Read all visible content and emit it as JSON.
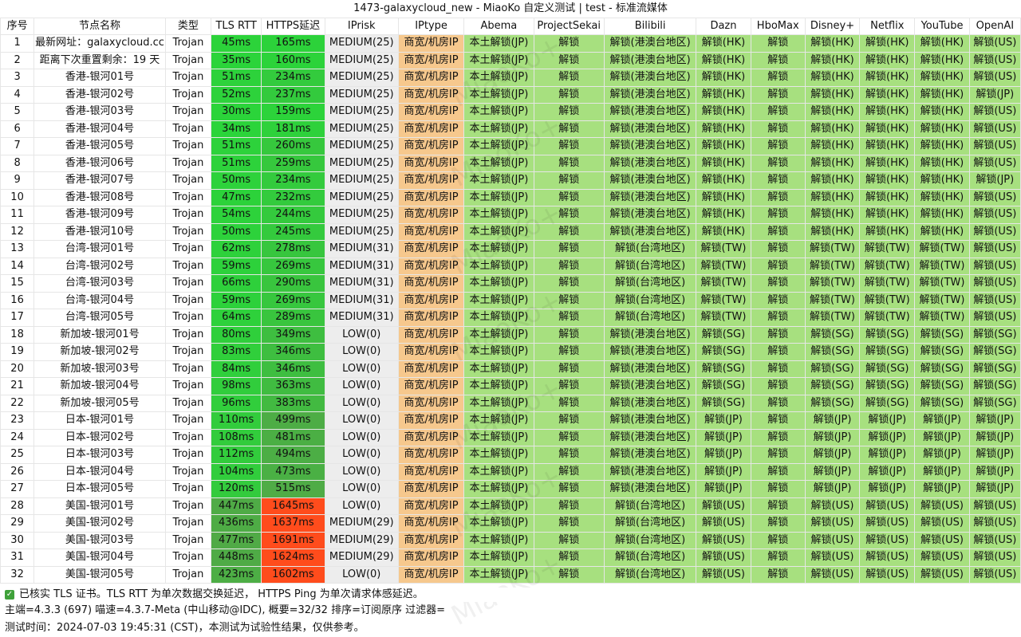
{
  "title": "1473-galaxycloud_new - MiaoKo 自定义测试 | test - 标准流媒体",
  "headers": [
    "序号",
    "节点名称",
    "类型",
    "TLS RTT",
    "HTTPS延迟",
    "IPrisk",
    "IPtype",
    "Abema",
    "ProjectSekai",
    "Bilibili",
    "Dazn",
    "HboMax",
    "Disney+",
    "Netflix",
    "YouTube",
    "OpenAI"
  ],
  "rows": [
    [
      "1",
      "最新网址：galaxycloud.cc",
      "Trojan",
      "45ms",
      "165ms",
      "MEDIUM(25)",
      "商宽/机房IP",
      "本土解锁(JP)",
      "解锁",
      "解锁(港澳台地区)",
      "解锁(HK)",
      "解锁",
      "解锁(HK)",
      "解锁(HK)",
      "解锁(HK)",
      "解锁(US)"
    ],
    [
      "2",
      "距离下次重置剩余：19 天",
      "Trojan",
      "35ms",
      "160ms",
      "MEDIUM(25)",
      "商宽/机房IP",
      "本土解锁(JP)",
      "解锁",
      "解锁(港澳台地区)",
      "解锁(HK)",
      "解锁",
      "解锁(HK)",
      "解锁(HK)",
      "解锁(HK)",
      "解锁(US)"
    ],
    [
      "3",
      "香港-银河01号",
      "Trojan",
      "51ms",
      "234ms",
      "MEDIUM(25)",
      "商宽/机房IP",
      "本土解锁(JP)",
      "解锁",
      "解锁(港澳台地区)",
      "解锁(HK)",
      "解锁",
      "解锁(HK)",
      "解锁(HK)",
      "解锁(HK)",
      "解锁(US)"
    ],
    [
      "4",
      "香港-银河02号",
      "Trojan",
      "52ms",
      "237ms",
      "MEDIUM(25)",
      "商宽/机房IP",
      "本土解锁(JP)",
      "解锁",
      "解锁(港澳台地区)",
      "解锁(HK)",
      "解锁",
      "解锁(HK)",
      "解锁(HK)",
      "解锁(HK)",
      "解锁(JP)"
    ],
    [
      "5",
      "香港-银河03号",
      "Trojan",
      "30ms",
      "159ms",
      "MEDIUM(25)",
      "商宽/机房IP",
      "本土解锁(JP)",
      "解锁",
      "解锁(港澳台地区)",
      "解锁(HK)",
      "解锁",
      "解锁(HK)",
      "解锁(HK)",
      "解锁(HK)",
      "解锁(US)"
    ],
    [
      "6",
      "香港-银河04号",
      "Trojan",
      "34ms",
      "181ms",
      "MEDIUM(25)",
      "商宽/机房IP",
      "本土解锁(JP)",
      "解锁",
      "解锁(港澳台地区)",
      "解锁(HK)",
      "解锁",
      "解锁(HK)",
      "解锁(HK)",
      "解锁(HK)",
      "解锁(US)"
    ],
    [
      "7",
      "香港-银河05号",
      "Trojan",
      "51ms",
      "260ms",
      "MEDIUM(25)",
      "商宽/机房IP",
      "本土解锁(JP)",
      "解锁",
      "解锁(港澳台地区)",
      "解锁(HK)",
      "解锁",
      "解锁(HK)",
      "解锁(HK)",
      "解锁(HK)",
      "解锁(US)"
    ],
    [
      "8",
      "香港-银河06号",
      "Trojan",
      "51ms",
      "259ms",
      "MEDIUM(25)",
      "商宽/机房IP",
      "本土解锁(JP)",
      "解锁",
      "解锁(港澳台地区)",
      "解锁(HK)",
      "解锁",
      "解锁(HK)",
      "解锁(HK)",
      "解锁(HK)",
      "解锁(US)"
    ],
    [
      "9",
      "香港-银河07号",
      "Trojan",
      "50ms",
      "234ms",
      "MEDIUM(25)",
      "商宽/机房IP",
      "本土解锁(JP)",
      "解锁",
      "解锁(港澳台地区)",
      "解锁(HK)",
      "解锁",
      "解锁(HK)",
      "解锁(HK)",
      "解锁(HK)",
      "解锁(JP)"
    ],
    [
      "10",
      "香港-银河08号",
      "Trojan",
      "47ms",
      "232ms",
      "MEDIUM(25)",
      "商宽/机房IP",
      "本土解锁(JP)",
      "解锁",
      "解锁(港澳台地区)",
      "解锁(HK)",
      "解锁",
      "解锁(HK)",
      "解锁(HK)",
      "解锁(HK)",
      "解锁(US)"
    ],
    [
      "11",
      "香港-银河09号",
      "Trojan",
      "54ms",
      "244ms",
      "MEDIUM(25)",
      "商宽/机房IP",
      "本土解锁(JP)",
      "解锁",
      "解锁(港澳台地区)",
      "解锁(HK)",
      "解锁",
      "解锁(HK)",
      "解锁(HK)",
      "解锁(HK)",
      "解锁(US)"
    ],
    [
      "12",
      "香港-银河10号",
      "Trojan",
      "50ms",
      "245ms",
      "MEDIUM(25)",
      "商宽/机房IP",
      "本土解锁(JP)",
      "解锁",
      "解锁(港澳台地区)",
      "解锁(HK)",
      "解锁",
      "解锁(HK)",
      "解锁(HK)",
      "解锁(HK)",
      "解锁(US)"
    ],
    [
      "13",
      "台湾-银河01号",
      "Trojan",
      "62ms",
      "278ms",
      "MEDIUM(31)",
      "商宽/机房IP",
      "本土解锁(JP)",
      "解锁",
      "解锁(台湾地区)",
      "解锁(TW)",
      "解锁",
      "解锁(TW)",
      "解锁(TW)",
      "解锁(TW)",
      "解锁(US)"
    ],
    [
      "14",
      "台湾-银河02号",
      "Trojan",
      "59ms",
      "269ms",
      "MEDIUM(31)",
      "商宽/机房IP",
      "本土解锁(JP)",
      "解锁",
      "解锁(台湾地区)",
      "解锁(TW)",
      "解锁",
      "解锁(TW)",
      "解锁(TW)",
      "解锁(TW)",
      "解锁(US)"
    ],
    [
      "15",
      "台湾-银河03号",
      "Trojan",
      "66ms",
      "290ms",
      "MEDIUM(31)",
      "商宽/机房IP",
      "本土解锁(JP)",
      "解锁",
      "解锁(台湾地区)",
      "解锁(TW)",
      "解锁",
      "解锁(TW)",
      "解锁(TW)",
      "解锁(TW)",
      "解锁(US)"
    ],
    [
      "16",
      "台湾-银河04号",
      "Trojan",
      "59ms",
      "269ms",
      "MEDIUM(31)",
      "商宽/机房IP",
      "本土解锁(JP)",
      "解锁",
      "解锁(台湾地区)",
      "解锁(TW)",
      "解锁",
      "解锁(TW)",
      "解锁(TW)",
      "解锁(TW)",
      "解锁(US)"
    ],
    [
      "17",
      "台湾-银河05号",
      "Trojan",
      "64ms",
      "289ms",
      "MEDIUM(31)",
      "商宽/机房IP",
      "本土解锁(JP)",
      "解锁",
      "解锁(台湾地区)",
      "解锁(TW)",
      "解锁",
      "解锁(TW)",
      "解锁(TW)",
      "解锁(TW)",
      "解锁(US)"
    ],
    [
      "18",
      "新加坡-银河01号",
      "Trojan",
      "80ms",
      "349ms",
      "LOW(0)",
      "商宽/机房IP",
      "本土解锁(JP)",
      "解锁",
      "解锁(港澳台地区)",
      "解锁(SG)",
      "解锁",
      "解锁(SG)",
      "解锁(SG)",
      "解锁(SG)",
      "解锁(SG)"
    ],
    [
      "19",
      "新加坡-银河02号",
      "Trojan",
      "83ms",
      "346ms",
      "LOW(0)",
      "商宽/机房IP",
      "本土解锁(JP)",
      "解锁",
      "解锁(港澳台地区)",
      "解锁(SG)",
      "解锁",
      "解锁(SG)",
      "解锁(SG)",
      "解锁(SG)",
      "解锁(SG)"
    ],
    [
      "20",
      "新加坡-银河03号",
      "Trojan",
      "84ms",
      "346ms",
      "LOW(0)",
      "商宽/机房IP",
      "本土解锁(JP)",
      "解锁",
      "解锁(港澳台地区)",
      "解锁(SG)",
      "解锁",
      "解锁(SG)",
      "解锁(SG)",
      "解锁(SG)",
      "解锁(SG)"
    ],
    [
      "21",
      "新加坡-银河04号",
      "Trojan",
      "98ms",
      "363ms",
      "LOW(0)",
      "商宽/机房IP",
      "本土解锁(JP)",
      "解锁",
      "解锁(港澳台地区)",
      "解锁(SG)",
      "解锁",
      "解锁(SG)",
      "解锁(SG)",
      "解锁(SG)",
      "解锁(SG)"
    ],
    [
      "22",
      "新加坡-银河05号",
      "Trojan",
      "96ms",
      "383ms",
      "LOW(0)",
      "商宽/机房IP",
      "本土解锁(JP)",
      "解锁",
      "解锁(港澳台地区)",
      "解锁(SG)",
      "解锁",
      "解锁(SG)",
      "解锁(SG)",
      "解锁(SG)",
      "解锁(SG)"
    ],
    [
      "23",
      "日本-银河01号",
      "Trojan",
      "110ms",
      "499ms",
      "LOW(0)",
      "商宽/机房IP",
      "本土解锁(JP)",
      "解锁",
      "解锁(港澳台地区)",
      "解锁(JP)",
      "解锁",
      "解锁(JP)",
      "解锁(JP)",
      "解锁(JP)",
      "解锁(JP)"
    ],
    [
      "24",
      "日本-银河02号",
      "Trojan",
      "108ms",
      "481ms",
      "LOW(0)",
      "商宽/机房IP",
      "本土解锁(JP)",
      "解锁",
      "解锁(港澳台地区)",
      "解锁(JP)",
      "解锁",
      "解锁(JP)",
      "解锁(JP)",
      "解锁(JP)",
      "解锁(JP)"
    ],
    [
      "25",
      "日本-银河03号",
      "Trojan",
      "112ms",
      "494ms",
      "LOW(0)",
      "商宽/机房IP",
      "本土解锁(JP)",
      "解锁",
      "解锁(港澳台地区)",
      "解锁(JP)",
      "解锁",
      "解锁(JP)",
      "解锁(JP)",
      "解锁(JP)",
      "解锁(JP)"
    ],
    [
      "26",
      "日本-银河04号",
      "Trojan",
      "104ms",
      "473ms",
      "LOW(0)",
      "商宽/机房IP",
      "本土解锁(JP)",
      "解锁",
      "解锁(港澳台地区)",
      "解锁(JP)",
      "解锁",
      "解锁(JP)",
      "解锁(JP)",
      "解锁(JP)",
      "解锁(JP)"
    ],
    [
      "27",
      "日本-银河05号",
      "Trojan",
      "120ms",
      "515ms",
      "LOW(0)",
      "商宽/机房IP",
      "本土解锁(JP)",
      "解锁",
      "解锁(港澳台地区)",
      "解锁(JP)",
      "解锁",
      "解锁(JP)",
      "解锁(JP)",
      "解锁(JP)",
      "解锁(JP)"
    ],
    [
      "28",
      "美国-银河01号",
      "Trojan",
      "447ms",
      "1645ms",
      "LOW(0)",
      "商宽/机房IP",
      "本土解锁(JP)",
      "解锁",
      "解锁(台湾地区)",
      "解锁(US)",
      "解锁",
      "解锁(US)",
      "解锁(US)",
      "解锁(US)",
      "解锁(US)"
    ],
    [
      "29",
      "美国-银河02号",
      "Trojan",
      "436ms",
      "1637ms",
      "MEDIUM(29)",
      "商宽/机房IP",
      "本土解锁(JP)",
      "解锁",
      "解锁(台湾地区)",
      "解锁(US)",
      "解锁",
      "解锁(US)",
      "解锁(US)",
      "解锁(US)",
      "解锁(US)"
    ],
    [
      "30",
      "美国-银河03号",
      "Trojan",
      "477ms",
      "1691ms",
      "MEDIUM(29)",
      "商宽/机房IP",
      "本土解锁(JP)",
      "解锁",
      "解锁(台湾地区)",
      "解锁(US)",
      "解锁",
      "解锁(US)",
      "解锁(US)",
      "解锁(US)",
      "解锁(US)"
    ],
    [
      "31",
      "美国-银河04号",
      "Trojan",
      "448ms",
      "1624ms",
      "MEDIUM(29)",
      "商宽/机房IP",
      "本土解锁(JP)",
      "解锁",
      "解锁(台湾地区)",
      "解锁(US)",
      "解锁",
      "解锁(US)",
      "解锁(US)",
      "解锁(US)",
      "解锁(US)"
    ],
    [
      "32",
      "美国-银河05号",
      "Trojan",
      "423ms",
      "1602ms",
      "LOW(0)",
      "商宽/机房IP",
      "本土解锁(JP)",
      "解锁",
      "解锁(台湾地区)",
      "解锁(US)",
      "解锁",
      "解锁(US)",
      "解锁(US)",
      "解锁(US)",
      "解锁(US)"
    ]
  ],
  "footer": {
    "line1": "已核实 TLS 证书。TLS RTT 为单次数据交换延迟， HTTPS Ping 为单次请求体感延迟。",
    "line2": "主端=4.3.3 (697) 喵速=4.3.7-Meta (中山移动@IDC), 概要=32/32 排序=订阅原序 过滤器=",
    "line3": "测试时间：2024-07-03 19:45:31 (CST)，本测试为试验性结果，仅供参考。"
  },
  "watermark": "MiaoKo+",
  "colors": {
    "unlock": "#a7e07f",
    "iptype": "#f6c88d",
    "iprisk": "#ededed",
    "latency_fast": "#2bd43a",
    "latency_slow": "#ff4c1c"
  }
}
